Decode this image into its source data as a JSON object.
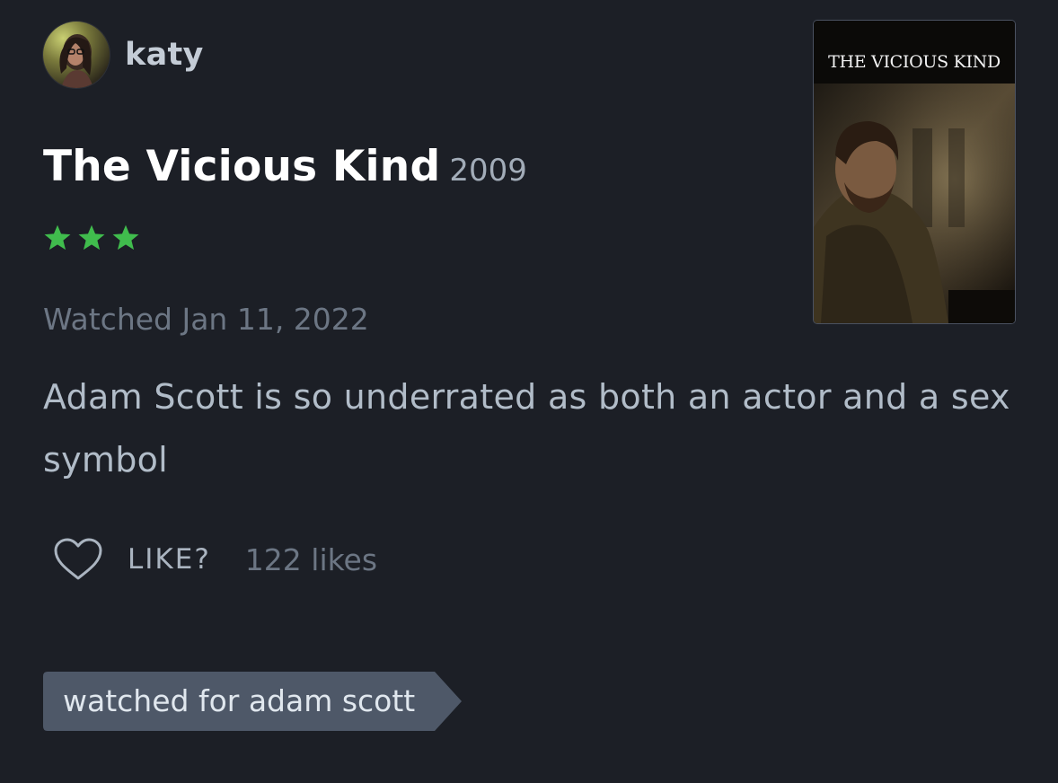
{
  "review": {
    "reviewer": {
      "username": "katy",
      "avatar_icon": "user-avatar"
    },
    "film": {
      "title": "The Vicious Kind",
      "year": "2009"
    },
    "rating": {
      "stars": 3,
      "max_stars": 5,
      "star_color": "#40bc4d",
      "icon": "star-icon"
    },
    "watched_date": "Watched Jan 11, 2022",
    "body": "Adam Scott is so underrated as both an actor and a sex symbol",
    "like": {
      "label": "LIKE?",
      "count_text": "122 likes",
      "icon": "heart-outline-icon"
    },
    "tags": [
      {
        "label": "watched for adam scott"
      }
    ],
    "poster": {
      "title_text": "THE VICIOUS KIND"
    }
  },
  "colors": {
    "background": "#1c1f26",
    "tag_background": "#4e5868",
    "title": "#ffffff",
    "muted": "#6c7684",
    "body": "#b1bcc8"
  }
}
